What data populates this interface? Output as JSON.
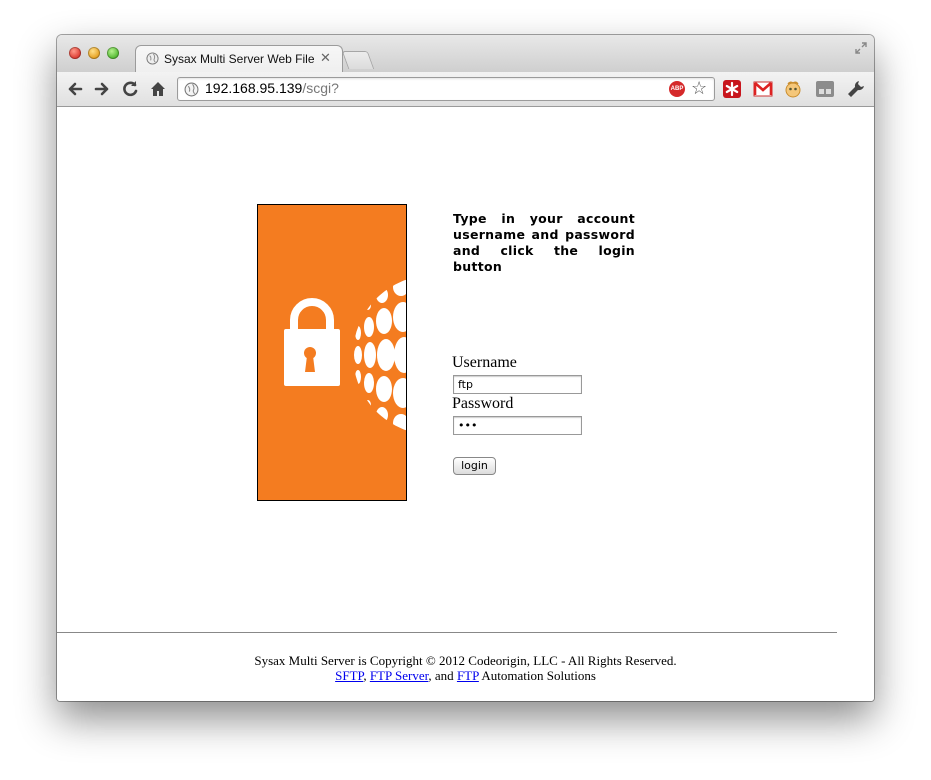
{
  "browser": {
    "tab_title": "Sysax Multi Server Web File A",
    "tab_close": "✕",
    "url_host": "192.168.95.139",
    "url_path": "/scgi?",
    "abp_label": "ABP"
  },
  "login": {
    "instructions": "Type in your account username and password and click the login button",
    "username_label": "Username",
    "username_value": "ftp",
    "password_label": "Password",
    "password_value": "•••",
    "login_button": "login"
  },
  "footer": {
    "copyright": "Sysax Multi Server is Copyright © 2012 Codeorigin, LLC - All Rights Reserved.",
    "link_sftp": "SFTP",
    "sep1": ", ",
    "link_ftp_server": "FTP Server",
    "sep2": ", and ",
    "link_ftp": "FTP",
    "tail": " Automation Solutions"
  },
  "colors": {
    "brand_orange": "#f47c20",
    "link_blue": "#0000ee"
  },
  "icons": [
    "back-icon",
    "forward-icon",
    "reload-icon",
    "home-icon",
    "globe-icon",
    "star-icon",
    "lastpass-icon",
    "gmail-icon",
    "extension-icon",
    "extension-gray-icon",
    "wrench-icon",
    "lock-icon",
    "globe-sphere-icon"
  ]
}
